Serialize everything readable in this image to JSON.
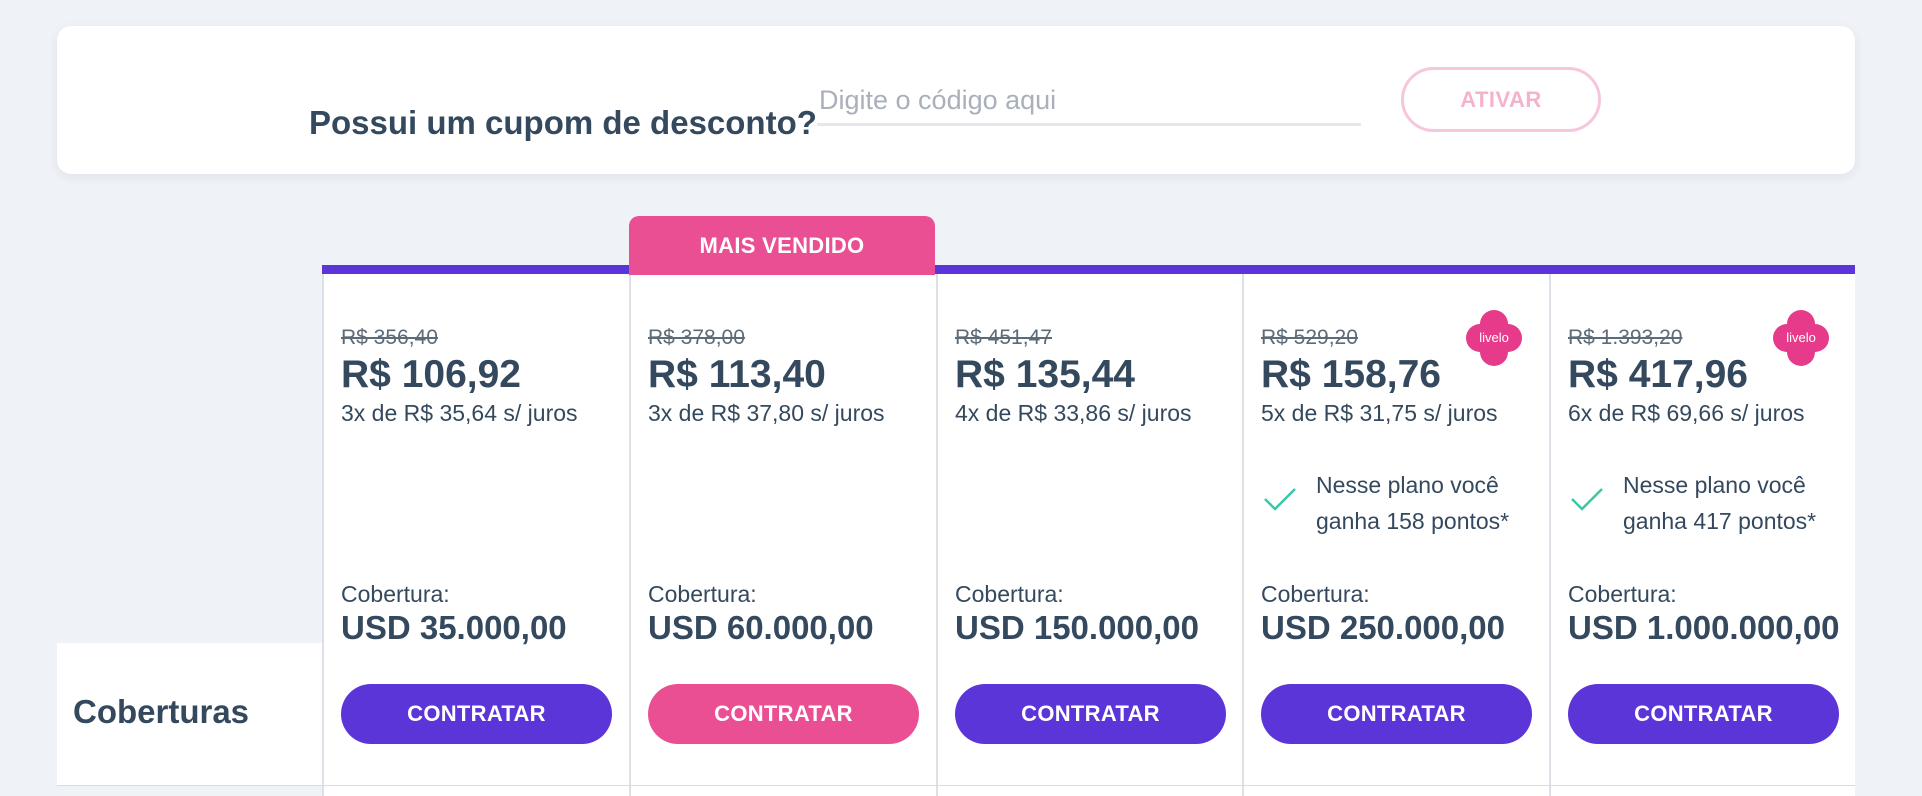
{
  "coupon": {
    "label": "Possui um cupom de desconto?",
    "placeholder": "Digite o código aqui",
    "activate_label": "ATIVAR"
  },
  "side": {
    "label": "Coberturas"
  },
  "badge": {
    "best_seller": "MAIS VENDIDO"
  },
  "colors": {
    "primary": "#5c35d9",
    "accent_pink": "#ea4f93",
    "text": "#34495e",
    "check": "#39c9a8"
  },
  "plans": [
    {
      "old_price": "R$ 356,40",
      "price": "R$ 106,92",
      "installments": "3x de R$ 35,64 s/ juros",
      "coverage_label": "Cobertura:",
      "coverage_value": "USD 35.000,00",
      "button_label": "CONTRATAR"
    },
    {
      "old_price": "R$ 378,00",
      "price": "R$ 113,40",
      "installments": "3x de R$ 37,80 s/ juros",
      "coverage_label": "Cobertura:",
      "coverage_value": "USD 60.000,00",
      "button_label": "CONTRATAR"
    },
    {
      "old_price": "R$ 451,47",
      "price": "R$ 135,44",
      "installments": "4x de R$ 33,86 s/ juros",
      "coverage_label": "Cobertura:",
      "coverage_value": "USD 150.000,00",
      "button_label": "CONTRATAR"
    },
    {
      "old_price": "R$ 529,20",
      "price": "R$ 158,76",
      "installments": "5x de R$ 31,75 s/ juros",
      "points_text": "Nesse plano você ganha 158 pontos*",
      "logo_text": "livelo",
      "coverage_label": "Cobertura:",
      "coverage_value": "USD 250.000,00",
      "button_label": "CONTRATAR"
    },
    {
      "old_price": "R$ 1.393,20",
      "price": "R$ 417,96",
      "installments": "6x de R$ 69,66 s/ juros",
      "points_text": "Nesse plano você ganha 417 pontos*",
      "logo_text": "livelo",
      "coverage_label": "Cobertura:",
      "coverage_value": "USD 1.000.000,00",
      "button_label": "CONTRATAR"
    }
  ]
}
